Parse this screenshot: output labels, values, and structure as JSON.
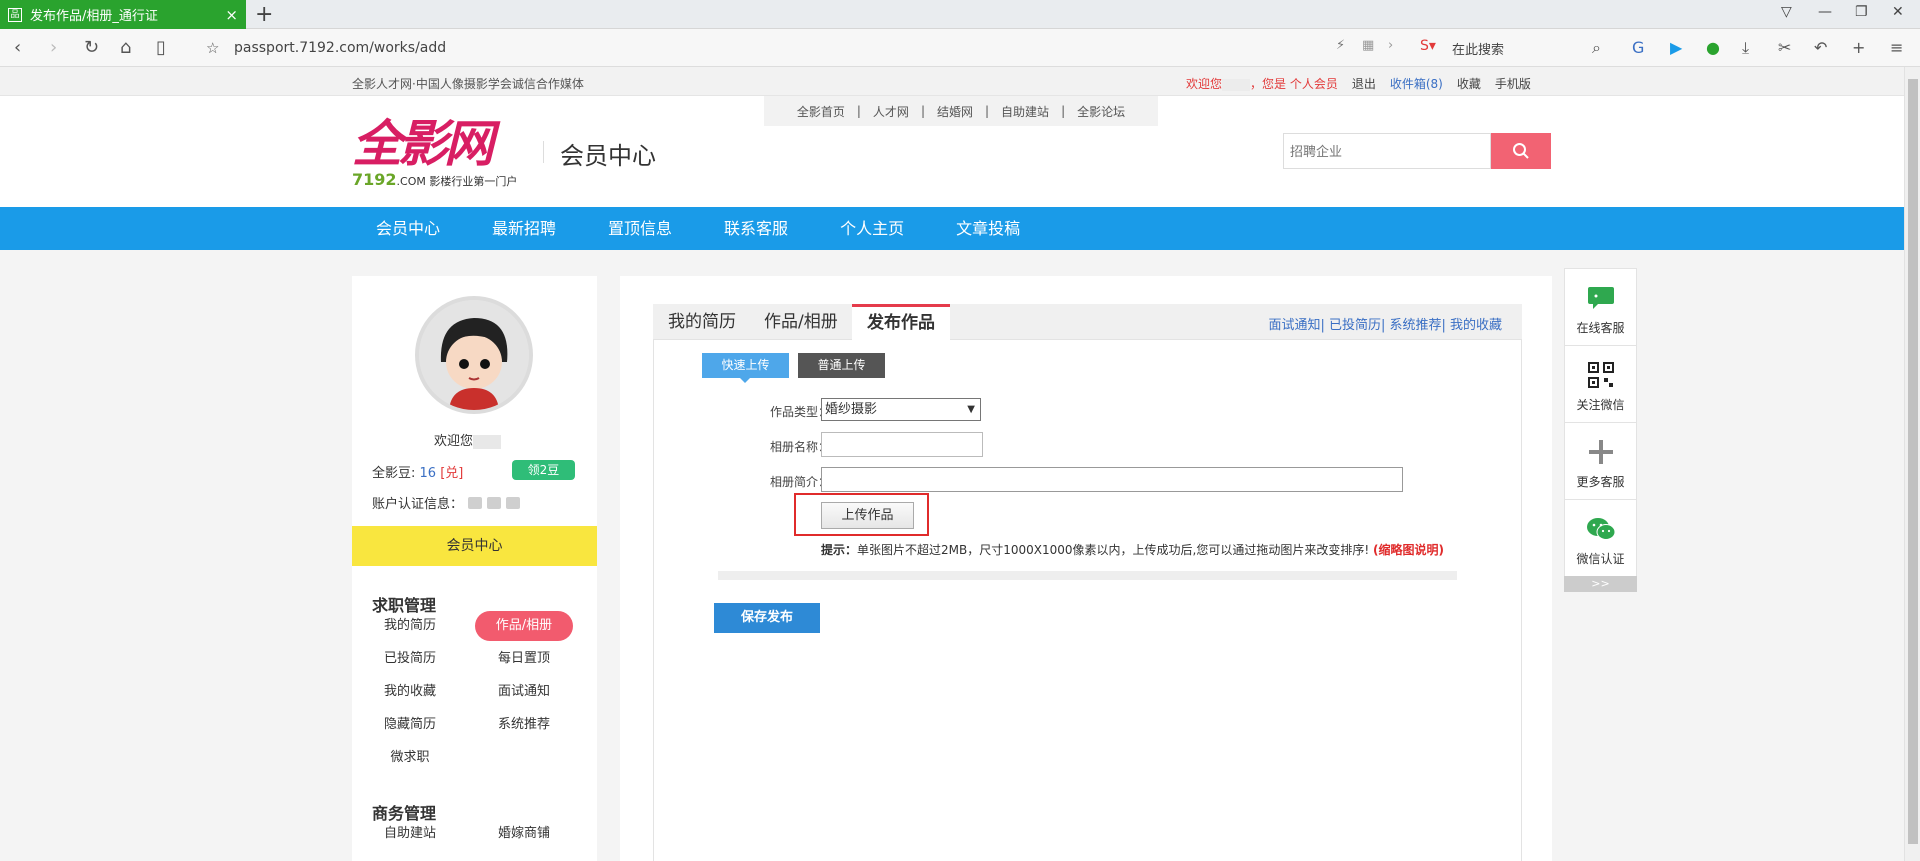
{
  "browser": {
    "tab_title": "发布作品/相册_通行证",
    "url": "passport.7192.com/works/add",
    "search_placeholder": "在此搜索"
  },
  "site_top": {
    "slogan": "全影人才网·中国人像摄影学会诚信合作媒体",
    "welcome_prefix": "欢迎您",
    "member_type": "，您是 个人会员",
    "logout": "退出",
    "inbox": "收件箱(8)",
    "favorites": "收藏",
    "mobile": "手机版"
  },
  "header": {
    "top_links": [
      "全影首页",
      "人才网",
      "结婚网",
      "自助建站",
      "全影论坛"
    ],
    "logo_text": "全影网",
    "logo_domain": "7192",
    "logo_com": ".COM",
    "logo_tagline": "影楼行业第一门户",
    "member_center": "会员中心",
    "search_placeholder": "招聘企业"
  },
  "main_nav": [
    "会员中心",
    "最新招聘",
    "置顶信息",
    "联系客服",
    "个人主页",
    "文章投稿"
  ],
  "sidebar": {
    "welcome": "欢迎您",
    "beans_label": "全影豆:",
    "beans_value": "16",
    "redeem": "[兑]",
    "get_beans": "领2豆",
    "auth_label": "账户认证信息：",
    "member_center": "会员中心",
    "section_job": "求职管理",
    "job_items": [
      "我的简历",
      "作品/相册",
      "已投简历",
      "每日置顶",
      "我的收藏",
      "面试通知",
      "隐藏简历",
      "系统推荐",
      "微求职"
    ],
    "section_business": "商务管理",
    "business_items": [
      "自助建站",
      "婚嫁商铺"
    ]
  },
  "main": {
    "tabs": [
      "我的简历",
      "作品/相册",
      "发布作品"
    ],
    "tab_links": "面试通知| 已投简历| 系统推荐| 我的收藏",
    "fast_upload": "快速上传",
    "normal_upload": "普通上传",
    "type_label": "作品类型：",
    "type_value": "婚纱摄影",
    "name_label": "相册名称：",
    "intro_label": "相册简介：",
    "upload_button": "上传作品",
    "tip_prefix": "提示：",
    "tip_text": "单张图片不超过2MB，尺寸1000X1000像素以内，上传成功后,您可以通过拖动图片来改变排序!",
    "tip_link": "(缩略图说明)",
    "save_button": "保存发布"
  },
  "right_float": [
    "在线客服",
    "关注微信",
    "更多客服",
    "微信认证"
  ],
  "right_float_more": ">>"
}
